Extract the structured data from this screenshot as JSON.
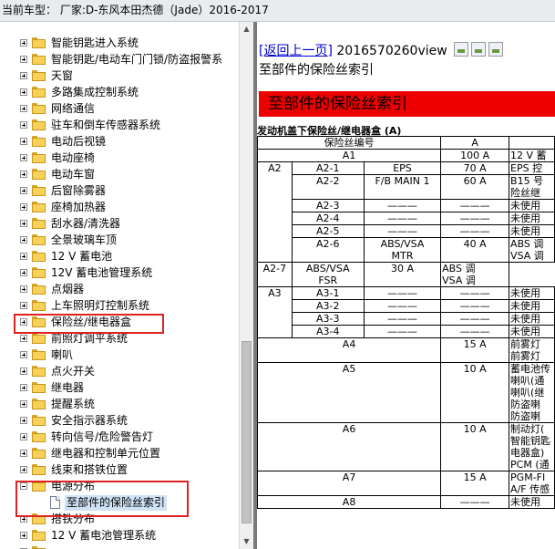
{
  "window": {
    "title": "当前车型：  厂家:D-东风本田杰德（Jade）2016-2017"
  },
  "tree": {
    "items": [
      {
        "label": "智能钥匙进入系统",
        "type": "folder",
        "level": 1
      },
      {
        "label": "智能钥匙/电动车门门锁/防盗报警系",
        "type": "folder",
        "level": 1
      },
      {
        "label": "天窗",
        "type": "folder",
        "level": 1
      },
      {
        "label": "多路集成控制系统",
        "type": "folder",
        "level": 1
      },
      {
        "label": "网络通信",
        "type": "folder",
        "level": 1
      },
      {
        "label": "驻车和倒车传感器系统",
        "type": "folder",
        "level": 1
      },
      {
        "label": "电动后视镜",
        "type": "folder",
        "level": 1
      },
      {
        "label": "电动座椅",
        "type": "folder",
        "level": 1
      },
      {
        "label": "电动车窗",
        "type": "folder",
        "level": 1
      },
      {
        "label": "后窗除雾器",
        "type": "folder",
        "level": 1
      },
      {
        "label": "座椅加热器",
        "type": "folder",
        "level": 1
      },
      {
        "label": "刮水器/清洗器",
        "type": "folder",
        "level": 1
      },
      {
        "label": "全景玻璃车顶",
        "type": "folder",
        "level": 1
      },
      {
        "label": "12 V 蓄电池",
        "type": "folder",
        "level": 1
      },
      {
        "label": "12V 蓄电池管理系统",
        "type": "folder",
        "level": 1
      },
      {
        "label": "点烟器",
        "type": "folder",
        "level": 1
      },
      {
        "label": "上车照明灯控制系统",
        "type": "folder",
        "level": 1
      },
      {
        "label": "保险丝/继电器盒",
        "type": "folder",
        "level": 1
      },
      {
        "label": "前照灯调平系统",
        "type": "folder",
        "level": 1
      },
      {
        "label": "喇叭",
        "type": "folder",
        "level": 1
      },
      {
        "label": "点火开关",
        "type": "folder",
        "level": 1
      },
      {
        "label": "继电器",
        "type": "folder",
        "level": 1
      },
      {
        "label": "提醒系统",
        "type": "folder",
        "level": 1
      },
      {
        "label": "安全指示器系统",
        "type": "folder",
        "level": 1
      },
      {
        "label": "转向信号/危险警告灯",
        "type": "folder",
        "level": 1
      },
      {
        "label": "继电器和控制单元位置",
        "type": "folder",
        "level": 1
      },
      {
        "label": "线束和搭铁位置",
        "type": "folder",
        "level": 1
      },
      {
        "label": "电源分布",
        "type": "folder-open",
        "level": 1
      },
      {
        "label": "至部件的保险丝索引",
        "type": "doc",
        "level": 2
      },
      {
        "label": "搭铁分布",
        "type": "folder",
        "level": 1
      },
      {
        "label": "12 V 蓄电池管理系统",
        "type": "folder",
        "level": 1
      },
      {
        "label": "",
        "type": "folder",
        "level": 1
      }
    ]
  },
  "content": {
    "back_link": "[返回上一页]",
    "view_id": " 2016570260view",
    "subheading": "至部件的保险丝索引",
    "banner": "至部件的保险丝索引",
    "table_title": "发动机盖下保险丝/继电器盒 (A)",
    "headers": {
      "fuse_no": "保险丝编号",
      "amp": "A",
      "desc": ""
    },
    "rows": [
      {
        "c1": "A1",
        "span": 3,
        "amp": "100 A",
        "desc": "12 V 蓄"
      },
      {
        "g": "A2",
        "gspan": 6,
        "c2": "A2-1",
        "c3": "EPS",
        "amp": "70 A",
        "desc": "EPS 控"
      },
      {
        "c2": "A2-2",
        "c3": "F/B MAIN 1",
        "amp": "60 A",
        "desc": "B15 号",
        "desc2": "险丝继"
      },
      {
        "c2": "A2-3",
        "c3": "———",
        "amp": "———",
        "desc": "未使用"
      },
      {
        "c2": "A2-4",
        "c3": "———",
        "amp": "———",
        "desc": "未使用"
      },
      {
        "c2": "A2-5",
        "c3": "———",
        "amp": "———",
        "desc": "未使用"
      },
      {
        "c2": "A2-6",
        "c3": "ABS/VSA",
        "c3b": "MTR",
        "amp": "40 A",
        "desc": "ABS 调",
        "desc2": "VSA 调"
      },
      {
        "c2": "A2-7",
        "c3": "ABS/VSA",
        "c3b": "FSR",
        "amp": "30 A",
        "desc": "ABS 调",
        "desc2": "VSA 调"
      },
      {
        "g": "A3",
        "gspan": 4,
        "c2": "A3-1",
        "c3": "———",
        "amp": "———",
        "desc": "未使用"
      },
      {
        "c2": "A3-2",
        "c3": "———",
        "amp": "———",
        "desc": "未使用"
      },
      {
        "c2": "A3-3",
        "c3": "———",
        "amp": "———",
        "desc": "未使用"
      },
      {
        "c2": "A3-4",
        "c3": "———",
        "amp": "———",
        "desc": "未使用"
      },
      {
        "c1": "A4",
        "span": 3,
        "amp": "15 A",
        "desc": "前雾灯",
        "desc2": "前雾灯"
      },
      {
        "c1": "A5",
        "span": 3,
        "amp": "10 A",
        "desc": "蓄电池传",
        "desc2": "喇叭(通",
        "desc3": "喇叭(继",
        "desc4": "防盗喇",
        "desc5": "防盗喇"
      },
      {
        "c1": "A6",
        "span": 3,
        "amp": "10 A",
        "desc": "制动灯(",
        "desc2": "智能钥匙",
        "desc3": "电器盒)",
        "desc4": "PCM (通"
      },
      {
        "c1": "A7",
        "span": 3,
        "amp": "15 A",
        "desc": "PGM-FI",
        "desc2": "A/F 传感"
      },
      {
        "c1": "A8",
        "span": 3,
        "amp": "———",
        "desc": "未使用"
      }
    ]
  }
}
